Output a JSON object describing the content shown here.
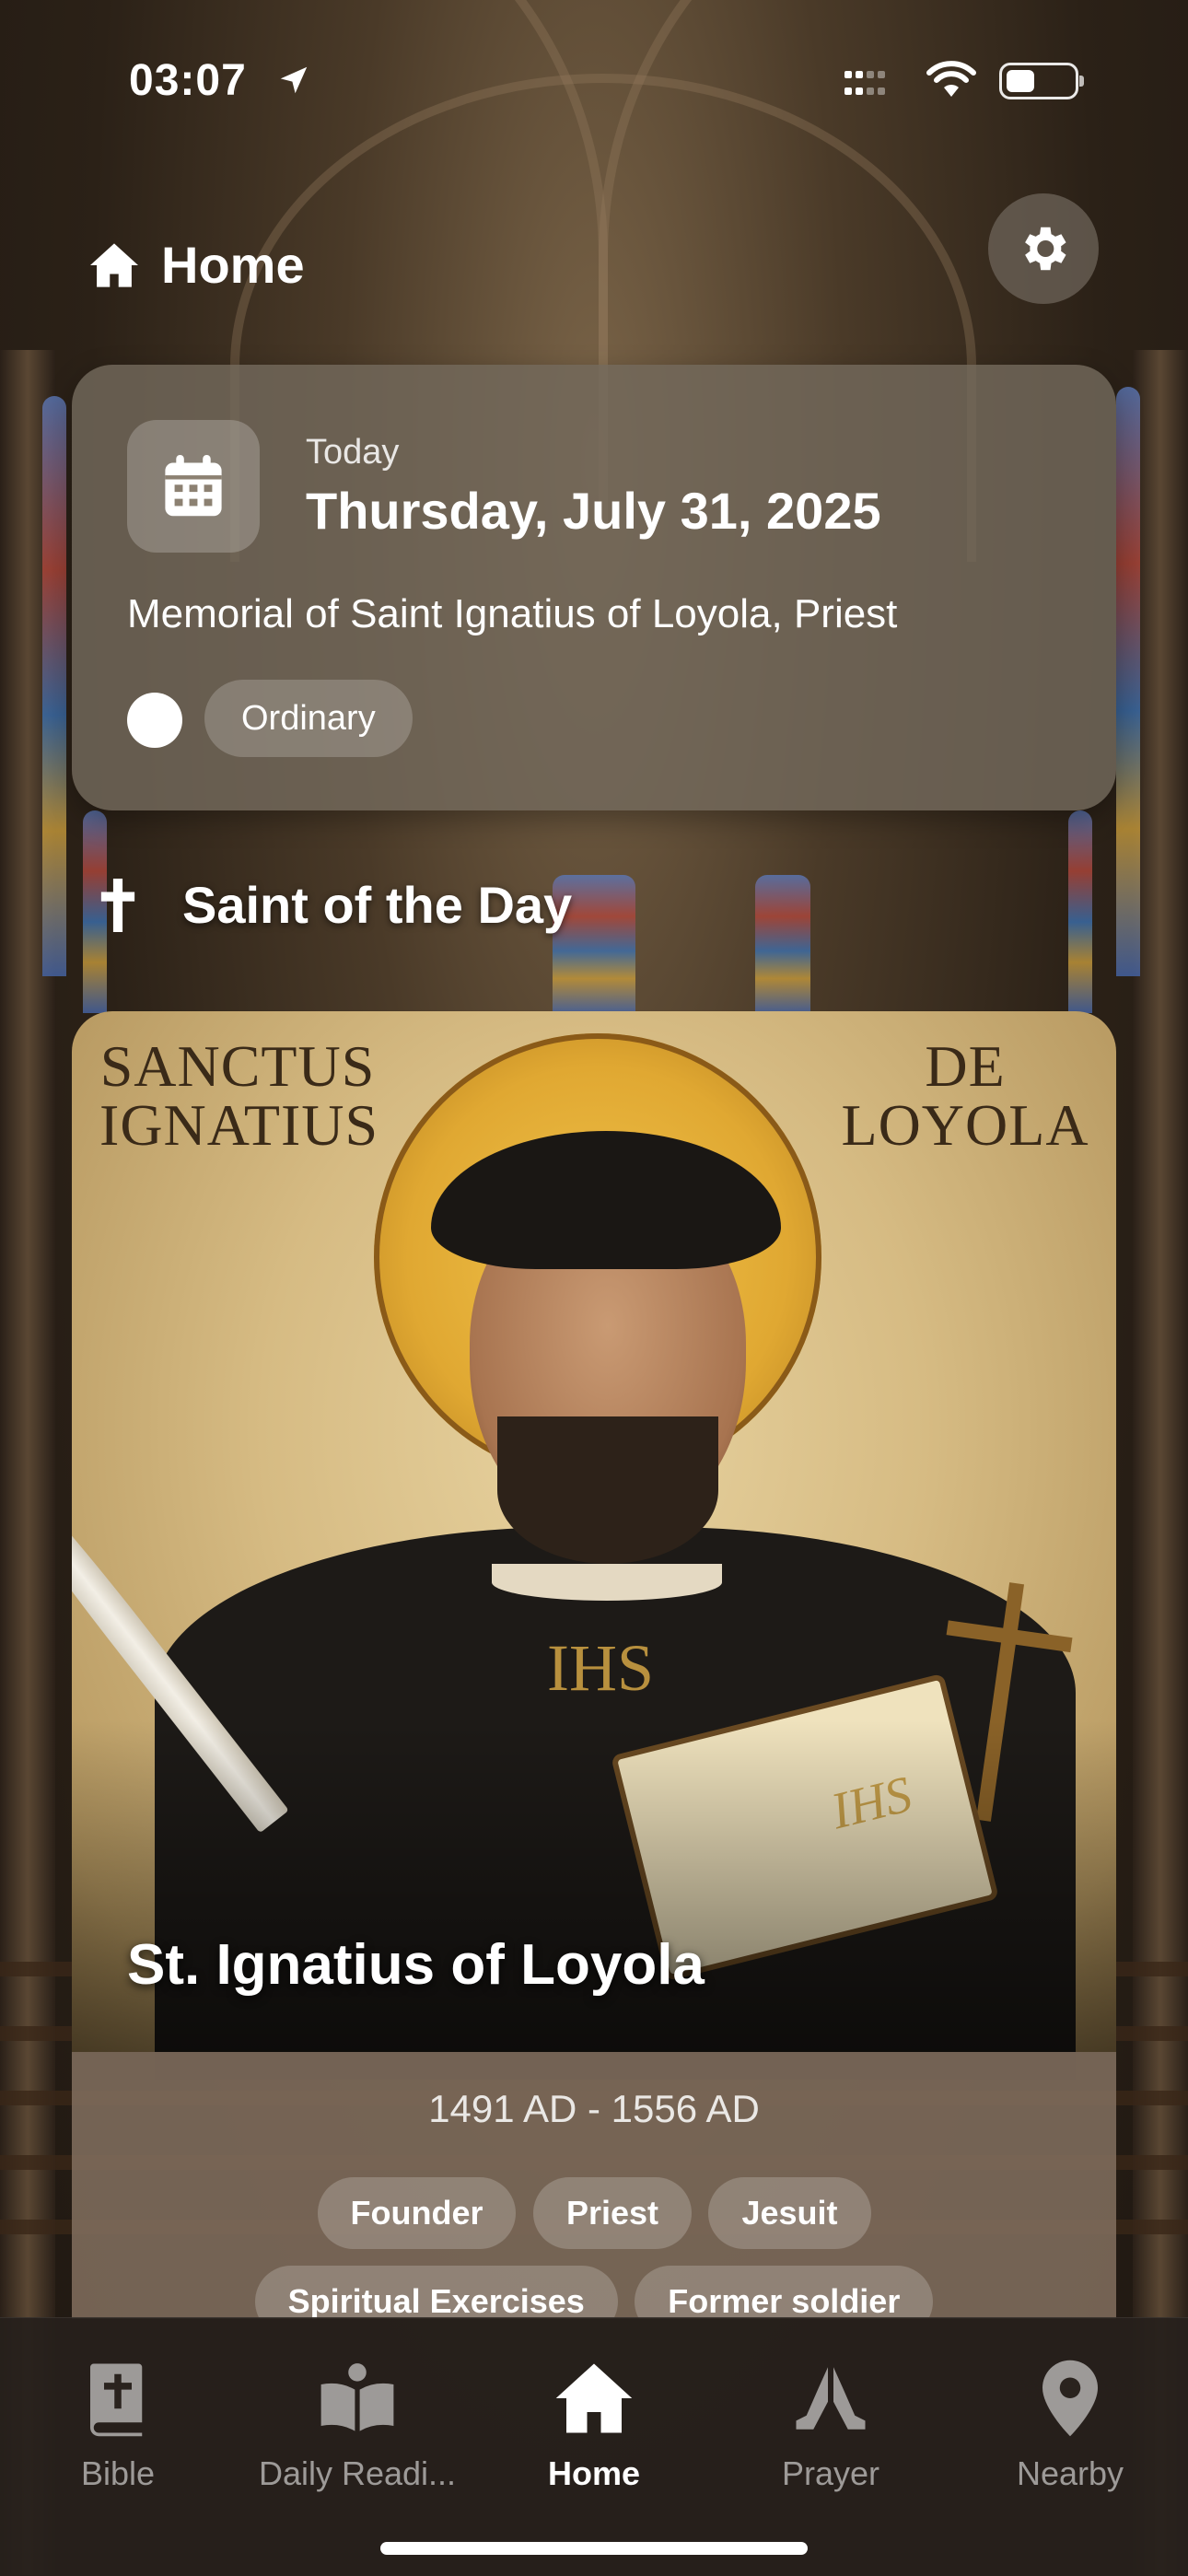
{
  "status_bar": {
    "time": "03:07"
  },
  "header": {
    "title": "Home"
  },
  "date_card": {
    "today_label": "Today",
    "date": "Thursday, July 31, 2025",
    "celebration": "Memorial of Saint Ignatius of Loyola, Priest",
    "season_color": "#ffffff",
    "season": "Ordinary"
  },
  "saint_section": {
    "title": "Saint of the Day",
    "inscription_left": "SANCTUS IGNATIUS",
    "inscription_right": "DE LOYOLA",
    "name": "St. Ignatius of Loyola",
    "years": "1491 AD - 1556 AD",
    "tags": [
      "Founder",
      "Priest",
      "Jesuit",
      "Spiritual Exercises",
      "Former soldier"
    ]
  },
  "tab_bar": {
    "tabs": [
      {
        "label": "Bible",
        "icon": "bible-icon",
        "active": false
      },
      {
        "label": "Daily Readi...",
        "icon": "open-book-icon",
        "active": false
      },
      {
        "label": "Home",
        "icon": "home-icon",
        "active": true
      },
      {
        "label": "Prayer",
        "icon": "praying-hands-icon",
        "active": false
      },
      {
        "label": "Nearby",
        "icon": "map-pin-icon",
        "active": false
      }
    ]
  }
}
